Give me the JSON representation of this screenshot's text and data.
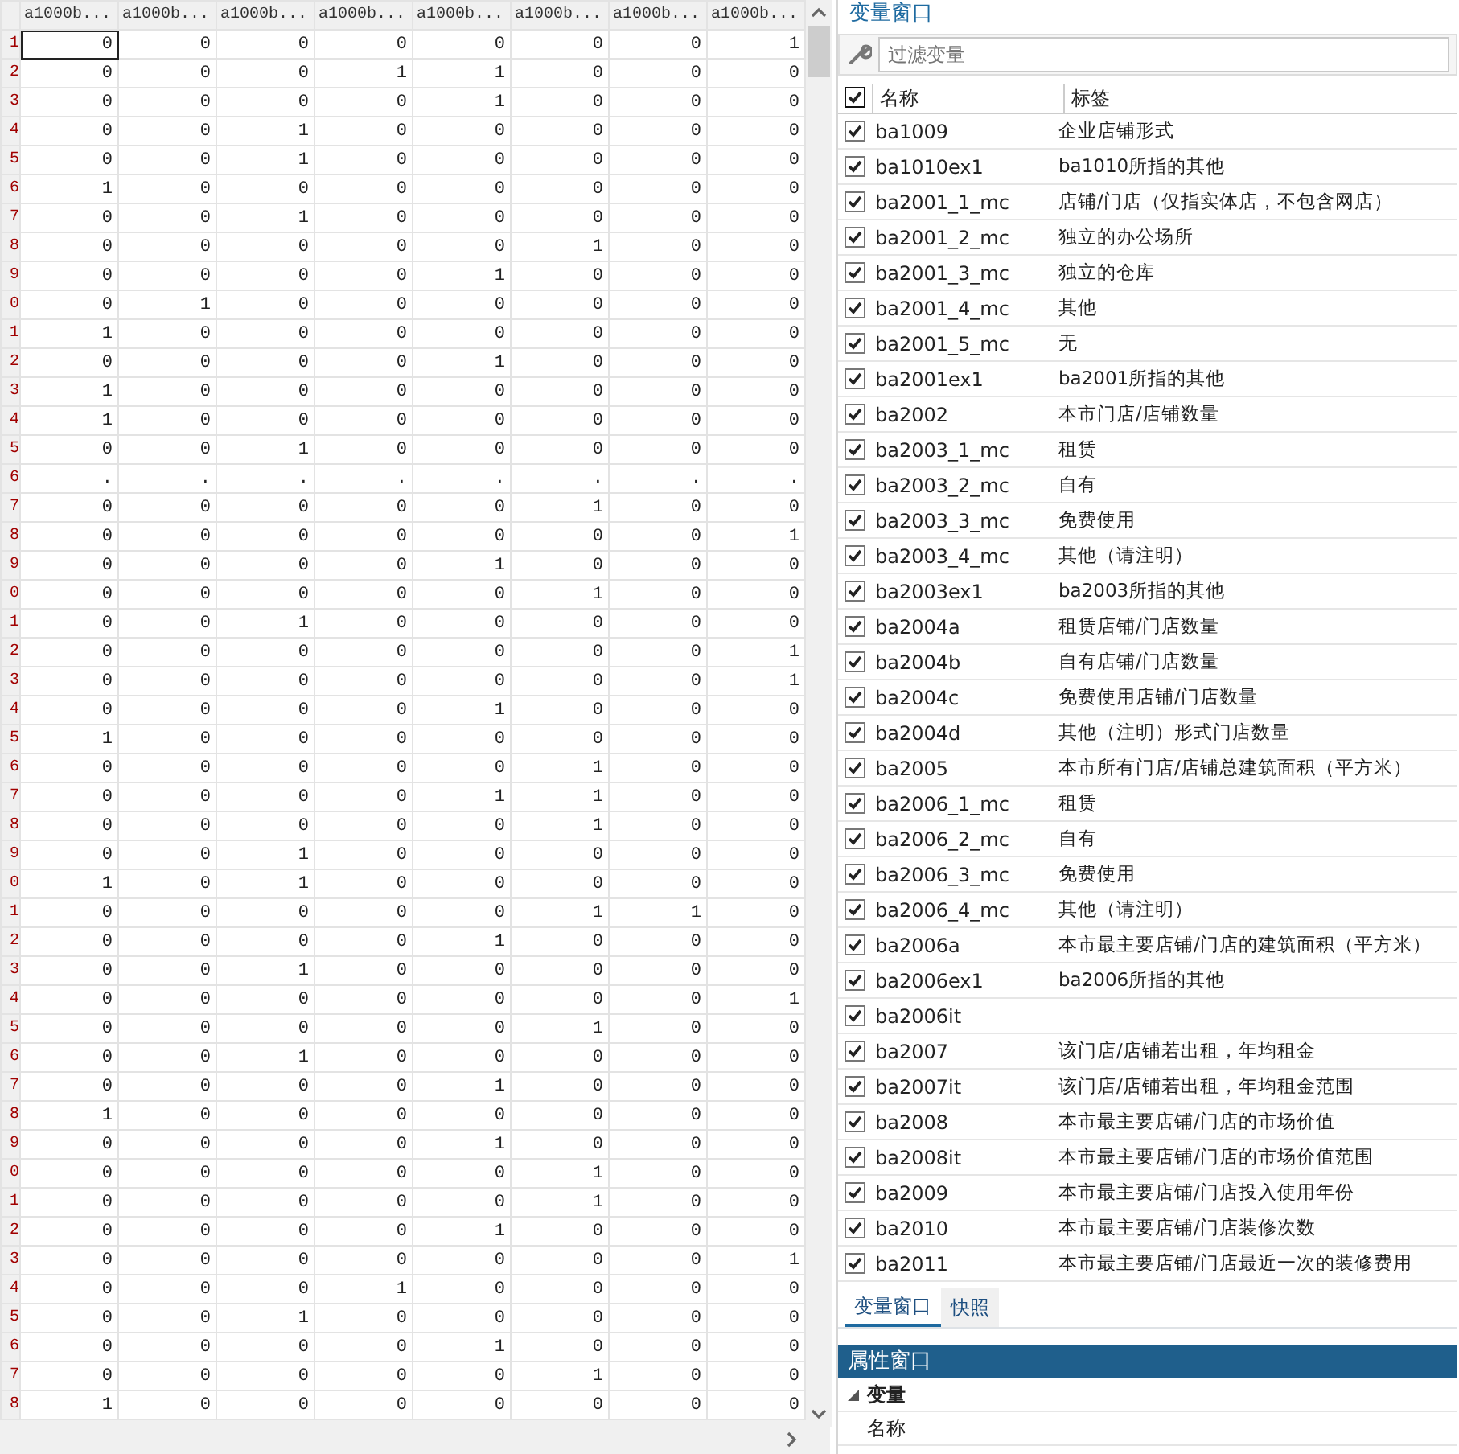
{
  "data_editor": {
    "columns": [
      "a1000b...",
      "a1000b...",
      "a1000b...",
      "a1000b...",
      "a1000b...",
      "a1000b...",
      "a1000b...",
      "a1000b..."
    ],
    "rows": [
      {
        "row_label": "1",
        "cells": [
          "0",
          "0",
          "0",
          "0",
          "0",
          "0",
          "0",
          "1"
        ]
      },
      {
        "row_label": "2",
        "cells": [
          "0",
          "0",
          "0",
          "1",
          "1",
          "0",
          "0",
          "0"
        ]
      },
      {
        "row_label": "3",
        "cells": [
          "0",
          "0",
          "0",
          "0",
          "1",
          "0",
          "0",
          "0"
        ]
      },
      {
        "row_label": "4",
        "cells": [
          "0",
          "0",
          "1",
          "0",
          "0",
          "0",
          "0",
          "0"
        ]
      },
      {
        "row_label": "5",
        "cells": [
          "0",
          "0",
          "1",
          "0",
          "0",
          "0",
          "0",
          "0"
        ]
      },
      {
        "row_label": "6",
        "cells": [
          "1",
          "0",
          "0",
          "0",
          "0",
          "0",
          "0",
          "0"
        ]
      },
      {
        "row_label": "7",
        "cells": [
          "0",
          "0",
          "1",
          "0",
          "0",
          "0",
          "0",
          "0"
        ]
      },
      {
        "row_label": "8",
        "cells": [
          "0",
          "0",
          "0",
          "0",
          "0",
          "1",
          "0",
          "0"
        ]
      },
      {
        "row_label": "9",
        "cells": [
          "0",
          "0",
          "0",
          "0",
          "1",
          "0",
          "0",
          "0"
        ]
      },
      {
        "row_label": "0",
        "cells": [
          "0",
          "1",
          "0",
          "0",
          "0",
          "0",
          "0",
          "0"
        ]
      },
      {
        "row_label": "1",
        "cells": [
          "1",
          "0",
          "0",
          "0",
          "0",
          "0",
          "0",
          "0"
        ]
      },
      {
        "row_label": "2",
        "cells": [
          "0",
          "0",
          "0",
          "0",
          "1",
          "0",
          "0",
          "0"
        ]
      },
      {
        "row_label": "3",
        "cells": [
          "1",
          "0",
          "0",
          "0",
          "0",
          "0",
          "0",
          "0"
        ]
      },
      {
        "row_label": "4",
        "cells": [
          "1",
          "0",
          "0",
          "0",
          "0",
          "0",
          "0",
          "0"
        ]
      },
      {
        "row_label": "5",
        "cells": [
          "0",
          "0",
          "1",
          "0",
          "0",
          "0",
          "0",
          "0"
        ]
      },
      {
        "row_label": "6",
        "cells": [
          ".",
          ".",
          ".",
          ".",
          ".",
          ".",
          ".",
          "."
        ]
      },
      {
        "row_label": "7",
        "cells": [
          "0",
          "0",
          "0",
          "0",
          "0",
          "1",
          "0",
          "0"
        ]
      },
      {
        "row_label": "8",
        "cells": [
          "0",
          "0",
          "0",
          "0",
          "0",
          "0",
          "0",
          "1"
        ]
      },
      {
        "row_label": "9",
        "cells": [
          "0",
          "0",
          "0",
          "0",
          "1",
          "0",
          "0",
          "0"
        ]
      },
      {
        "row_label": "0",
        "cells": [
          "0",
          "0",
          "0",
          "0",
          "0",
          "1",
          "0",
          "0"
        ]
      },
      {
        "row_label": "1",
        "cells": [
          "0",
          "0",
          "1",
          "0",
          "0",
          "0",
          "0",
          "0"
        ]
      },
      {
        "row_label": "2",
        "cells": [
          "0",
          "0",
          "0",
          "0",
          "0",
          "0",
          "0",
          "1"
        ]
      },
      {
        "row_label": "3",
        "cells": [
          "0",
          "0",
          "0",
          "0",
          "0",
          "0",
          "0",
          "1"
        ]
      },
      {
        "row_label": "4",
        "cells": [
          "0",
          "0",
          "0",
          "0",
          "1",
          "0",
          "0",
          "0"
        ]
      },
      {
        "row_label": "5",
        "cells": [
          "1",
          "0",
          "0",
          "0",
          "0",
          "0",
          "0",
          "0"
        ]
      },
      {
        "row_label": "6",
        "cells": [
          "0",
          "0",
          "0",
          "0",
          "0",
          "1",
          "0",
          "0"
        ]
      },
      {
        "row_label": "7",
        "cells": [
          "0",
          "0",
          "0",
          "0",
          "1",
          "1",
          "0",
          "0"
        ]
      },
      {
        "row_label": "8",
        "cells": [
          "0",
          "0",
          "0",
          "0",
          "0",
          "1",
          "0",
          "0"
        ]
      },
      {
        "row_label": "9",
        "cells": [
          "0",
          "0",
          "1",
          "0",
          "0",
          "0",
          "0",
          "0"
        ]
      },
      {
        "row_label": "0",
        "cells": [
          "1",
          "0",
          "1",
          "0",
          "0",
          "0",
          "0",
          "0"
        ]
      },
      {
        "row_label": "1",
        "cells": [
          "0",
          "0",
          "0",
          "0",
          "0",
          "1",
          "1",
          "0"
        ]
      },
      {
        "row_label": "2",
        "cells": [
          "0",
          "0",
          "0",
          "0",
          "1",
          "0",
          "0",
          "0"
        ]
      },
      {
        "row_label": "3",
        "cells": [
          "0",
          "0",
          "1",
          "0",
          "0",
          "0",
          "0",
          "0"
        ]
      },
      {
        "row_label": "4",
        "cells": [
          "0",
          "0",
          "0",
          "0",
          "0",
          "0",
          "0",
          "1"
        ]
      },
      {
        "row_label": "5",
        "cells": [
          "0",
          "0",
          "0",
          "0",
          "0",
          "1",
          "0",
          "0"
        ]
      },
      {
        "row_label": "6",
        "cells": [
          "0",
          "0",
          "1",
          "0",
          "0",
          "0",
          "0",
          "0"
        ]
      },
      {
        "row_label": "7",
        "cells": [
          "0",
          "0",
          "0",
          "0",
          "1",
          "0",
          "0",
          "0"
        ]
      },
      {
        "row_label": "8",
        "cells": [
          "1",
          "0",
          "0",
          "0",
          "0",
          "0",
          "0",
          "0"
        ]
      },
      {
        "row_label": "9",
        "cells": [
          "0",
          "0",
          "0",
          "0",
          "1",
          "0",
          "0",
          "0"
        ]
      },
      {
        "row_label": "0",
        "cells": [
          "0",
          "0",
          "0",
          "0",
          "0",
          "1",
          "0",
          "0"
        ]
      },
      {
        "row_label": "1",
        "cells": [
          "0",
          "0",
          "0",
          "0",
          "0",
          "1",
          "0",
          "0"
        ]
      },
      {
        "row_label": "2",
        "cells": [
          "0",
          "0",
          "0",
          "0",
          "1",
          "0",
          "0",
          "0"
        ]
      },
      {
        "row_label": "3",
        "cells": [
          "0",
          "0",
          "0",
          "0",
          "0",
          "0",
          "0",
          "1"
        ]
      },
      {
        "row_label": "4",
        "cells": [
          "0",
          "0",
          "0",
          "1",
          "0",
          "0",
          "0",
          "0"
        ]
      },
      {
        "row_label": "5",
        "cells": [
          "0",
          "0",
          "1",
          "0",
          "0",
          "0",
          "0",
          "0"
        ]
      },
      {
        "row_label": "6",
        "cells": [
          "0",
          "0",
          "0",
          "0",
          "1",
          "0",
          "0",
          "0"
        ]
      },
      {
        "row_label": "7",
        "cells": [
          "0",
          "0",
          "0",
          "0",
          "0",
          "1",
          "0",
          "0"
        ]
      },
      {
        "row_label": "8",
        "cells": [
          "1",
          "0",
          "0",
          "0",
          "0",
          "0",
          "0",
          "0"
        ]
      }
    ]
  },
  "variables_window": {
    "title": "变量窗口",
    "filter": {
      "placeholder": "过滤变量"
    },
    "header": {
      "checked": true,
      "name": "名称",
      "label": "标签"
    },
    "variables": [
      {
        "name": "ba1009",
        "label": "企业店铺形式",
        "checked": true
      },
      {
        "name": "ba1010ex1",
        "label": "ba1010所指的其他",
        "checked": true
      },
      {
        "name": "ba2001_1_mc",
        "label": "店铺/门店（仅指实体店，不包含网店）",
        "checked": true
      },
      {
        "name": "ba2001_2_mc",
        "label": "独立的办公场所",
        "checked": true
      },
      {
        "name": "ba2001_3_mc",
        "label": "独立的仓库",
        "checked": true
      },
      {
        "name": "ba2001_4_mc",
        "label": "其他",
        "checked": true
      },
      {
        "name": "ba2001_5_mc",
        "label": "无",
        "checked": true
      },
      {
        "name": "ba2001ex1",
        "label": "ba2001所指的其他",
        "checked": true
      },
      {
        "name": "ba2002",
        "label": "本市门店/店铺数量",
        "checked": true
      },
      {
        "name": "ba2003_1_mc",
        "label": "租赁",
        "checked": true
      },
      {
        "name": "ba2003_2_mc",
        "label": "自有",
        "checked": true
      },
      {
        "name": "ba2003_3_mc",
        "label": "免费使用",
        "checked": true
      },
      {
        "name": "ba2003_4_mc",
        "label": "其他（请注明）",
        "checked": true
      },
      {
        "name": "ba2003ex1",
        "label": "ba2003所指的其他",
        "checked": true
      },
      {
        "name": "ba2004a",
        "label": "租赁店铺/门店数量",
        "checked": true
      },
      {
        "name": "ba2004b",
        "label": "自有店铺/门店数量",
        "checked": true
      },
      {
        "name": "ba2004c",
        "label": "免费使用店铺/门店数量",
        "checked": true
      },
      {
        "name": "ba2004d",
        "label": "其他（注明）形式门店数量",
        "checked": true
      },
      {
        "name": "ba2005",
        "label": "本市所有门店/店铺总建筑面积（平方米）",
        "checked": true
      },
      {
        "name": "ba2006_1_mc",
        "label": "租赁",
        "checked": true
      },
      {
        "name": "ba2006_2_mc",
        "label": "自有",
        "checked": true
      },
      {
        "name": "ba2006_3_mc",
        "label": "免费使用",
        "checked": true
      },
      {
        "name": "ba2006_4_mc",
        "label": "其他（请注明）",
        "checked": true
      },
      {
        "name": "ba2006a",
        "label": "本市最主要店铺/门店的建筑面积（平方米）",
        "checked": true
      },
      {
        "name": "ba2006ex1",
        "label": "ba2006所指的其他",
        "checked": true
      },
      {
        "name": "ba2006it",
        "checked": true
      },
      {
        "name": "ba2007",
        "label": "该门店/店铺若出租，年均租金",
        "checked": true
      },
      {
        "name": "ba2007it",
        "label": "该门店/店铺若出租，年均租金范围",
        "checked": true
      },
      {
        "name": "ba2008",
        "label": "本市最主要店铺/门店的市场价值",
        "checked": true
      },
      {
        "name": "ba2008it",
        "label": "本市最主要店铺/门店的市场价值范围",
        "checked": true
      },
      {
        "name": "ba2009",
        "label": "本市最主要店铺/门店投入使用年份",
        "checked": true
      },
      {
        "name": "ba2010",
        "label": "本市最主要店铺/门店装修次数",
        "checked": true
      },
      {
        "name": "ba2011",
        "label": "本市最主要店铺/门店最近一次的装修费用",
        "checked": true
      }
    ]
  },
  "tabs": [
    {
      "label": "变量窗口",
      "selected": true
    },
    {
      "label": "快照",
      "selected": false
    }
  ],
  "properties_window": {
    "title": "属性窗口",
    "groups": [
      {
        "label": "变量",
        "expanded": true,
        "children": [
          {
            "label": "名称"
          }
        ]
      }
    ]
  }
}
